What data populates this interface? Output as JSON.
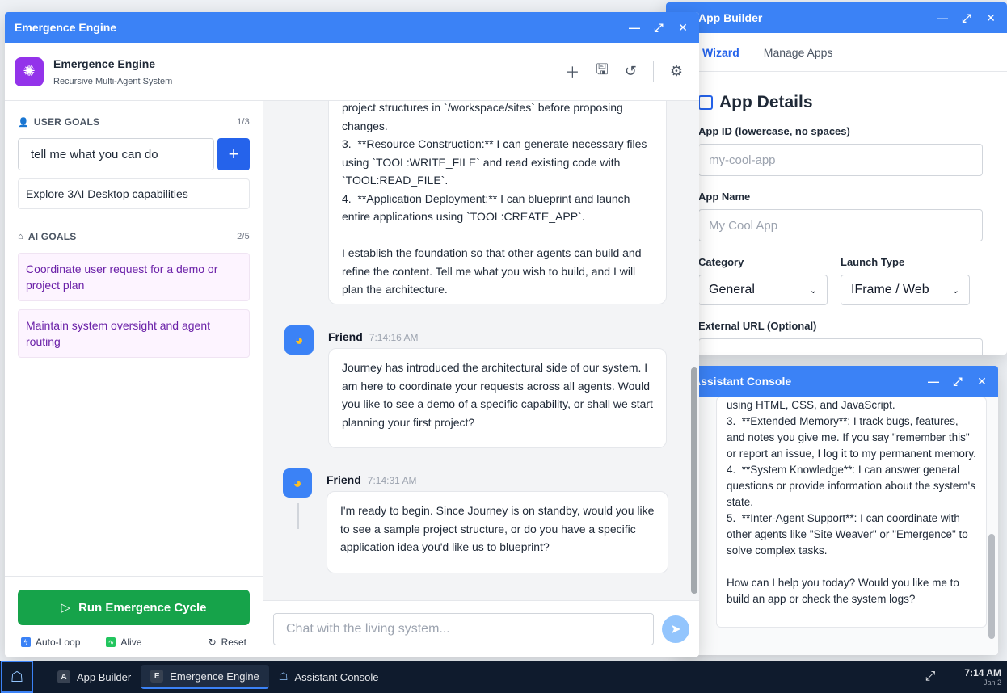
{
  "app_builder": {
    "title": "App Builder",
    "tabs": [
      "Wizard",
      "Manage Apps"
    ],
    "section_title": "App Details",
    "app_id_label": "App ID (lowercase, no spaces)",
    "app_id_placeholder": "my-cool-app",
    "app_name_label": "App Name",
    "app_name_placeholder": "My Cool App",
    "category_label": "Category",
    "category_value": "General",
    "launch_type_label": "Launch Type",
    "launch_type_value": "IFrame / Web",
    "external_url_label": "External URL (Optional)"
  },
  "console": {
    "title": "Assistant Console",
    "message": "using HTML, CSS, and JavaScript.\n3.  **Extended Memory**: I track bugs, features, and notes you give me. If you say \"remember this\" or report an issue, I log it to my permanent memory.\n4.  **System Knowledge**: I can answer general questions or provide information about the system's state.\n5.  **Inter-Agent Support**: I can coordinate with other agents like \"Site Weaver\" or \"Emergence\" to solve complex tasks.\n\nHow can I help you today? Would you like me to build an app or check the system logs?"
  },
  "engine": {
    "window_title": "Emergence Engine",
    "app_name": "Emergence Engine",
    "subtitle": "Recursive Multi-Agent System",
    "user_goals": {
      "heading": "USER GOALS",
      "count": "1/3",
      "input_value": "tell me what you can do",
      "items": [
        "Explore 3AI Desktop capabilities"
      ]
    },
    "ai_goals": {
      "heading": "AI GOALS",
      "count": "2/5",
      "items": [
        "Coordinate user request for a demo or project plan",
        "Maintain system oversight and agent routing"
      ]
    },
    "run_button": "Run Emergence Cycle",
    "auto_loop": "Auto-Loop",
    "alive": "Alive",
    "reset": "Reset",
    "chat_placeholder": "Chat with the living system...",
    "messages": [
      {
        "text": "project structures in `/workspace/sites` before proposing changes.\n3.  **Resource Construction:** I can generate necessary files using `TOOL:WRITE_FILE` and read existing code with `TOOL:READ_FILE`.\n4.  **Application Deployment:** I can blueprint and launch entire applications using `TOOL:CREATE_APP`.\n\nI establish the foundation so that other agents can build and refine the content. Tell me what you wish to build, and I will plan the architecture."
      },
      {
        "sender": "Friend",
        "time": "7:14:16 AM",
        "text": "Journey has introduced the architectural side of our system. I am here to coordinate your requests across all agents. Would you like to see a demo of a specific capability, or shall we start planning your first project?"
      },
      {
        "sender": "Friend",
        "time": "7:14:31 AM",
        "text": "I'm ready to begin. Since Journey is on standby, would you like to see a sample project structure, or do you have a specific application idea you'd like us to blueprint?"
      }
    ]
  },
  "taskbar": {
    "items": [
      {
        "badge": "A",
        "label": "App Builder"
      },
      {
        "badge": "E",
        "label": "Emergence Engine"
      },
      {
        "label": "Assistant Console"
      }
    ],
    "time": "7:14 AM",
    "date": "Jan 2"
  }
}
